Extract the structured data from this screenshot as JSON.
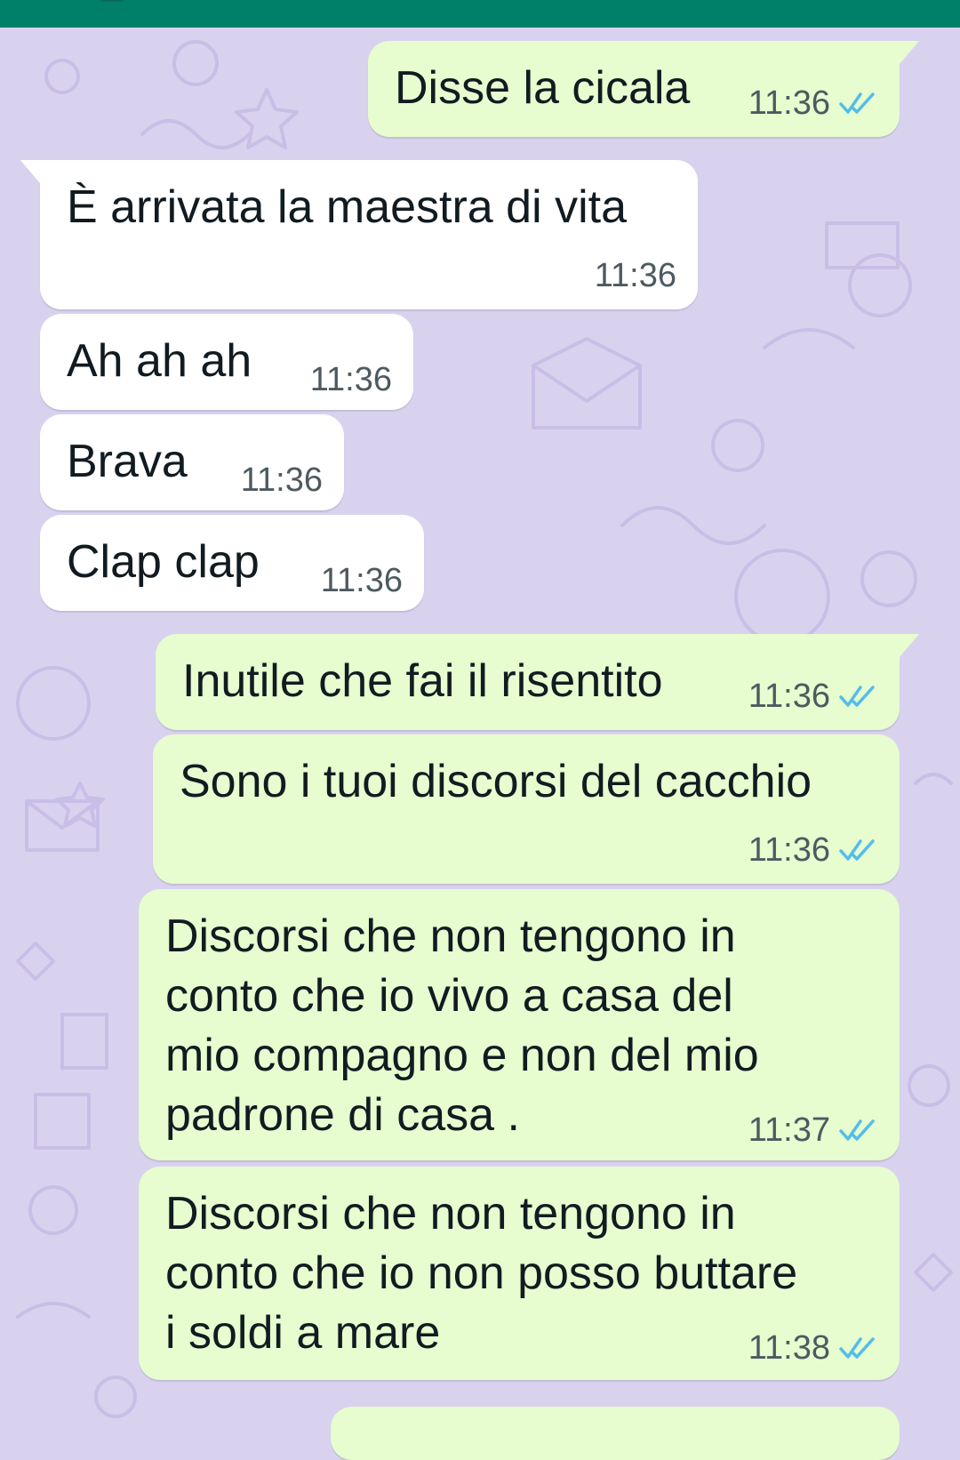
{
  "colors": {
    "header": "#008069",
    "wallpaper": "#d9d2ef",
    "outgoing_bubble": "#e7fccf",
    "incoming_bubble": "#ffffff",
    "read_ticks": "#53bdeb"
  },
  "messages": [
    {
      "direction": "outgoing",
      "lines": [
        "Disse la cicala"
      ],
      "time": "11:36",
      "status": "read-ticks-icon"
    },
    {
      "direction": "incoming",
      "lines": [
        "È arrivata la maestra di vita"
      ],
      "time": "11:36"
    },
    {
      "direction": "incoming",
      "lines": [
        "Ah ah ah"
      ],
      "time": "11:36"
    },
    {
      "direction": "incoming",
      "lines": [
        "Brava"
      ],
      "time": "11:36"
    },
    {
      "direction": "incoming",
      "lines": [
        "Clap clap"
      ],
      "time": "11:36"
    },
    {
      "direction": "outgoing",
      "lines": [
        "Inutile che fai il risentito"
      ],
      "time": "11:36",
      "status": "read-ticks-icon"
    },
    {
      "direction": "outgoing",
      "lines": [
        "Sono i tuoi discorsi del cacchio"
      ],
      "time": "11:36",
      "status": "read-ticks-icon"
    },
    {
      "direction": "outgoing",
      "lines": [
        "Discorsi che non tengono in",
        "conto che io vivo a casa del",
        "mio compagno e non del mio",
        "padrone di casa ."
      ],
      "time": "11:37",
      "status": "read-ticks-icon"
    },
    {
      "direction": "outgoing",
      "lines": [
        "Discorsi che non tengono in",
        "conto che io non posso buttare",
        "i soldi a mare"
      ],
      "time": "11:38",
      "status": "read-ticks-icon"
    }
  ]
}
